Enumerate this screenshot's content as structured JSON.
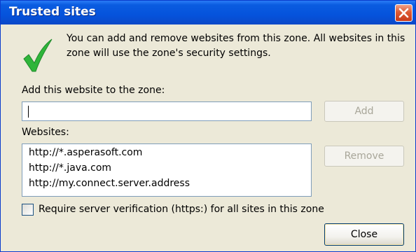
{
  "window": {
    "title": "Trusted sites"
  },
  "info": {
    "text": "You can add and remove websites from this zone. All websites in this zone will use the zone's security settings."
  },
  "add_site": {
    "label": "Add this website to the zone:",
    "value": "",
    "button_label": "Add"
  },
  "websites": {
    "label": "Websites:",
    "items": [
      "http://*.asperasoft.com",
      "http://*.java.com",
      "http://my.connect.server.address"
    ],
    "remove_label": "Remove"
  },
  "verification": {
    "label": "Require server verification (https:) for all sites in this zone",
    "checked": false
  },
  "footer": {
    "close_label": "Close"
  },
  "icons": {
    "info": "checkmark-icon",
    "title_close": "close-icon"
  },
  "colors": {
    "titlebar": "#0553dc",
    "close_button": "#dd5a34",
    "checkmark": "#2fb53a",
    "dialog_background": "#ece9d8"
  }
}
